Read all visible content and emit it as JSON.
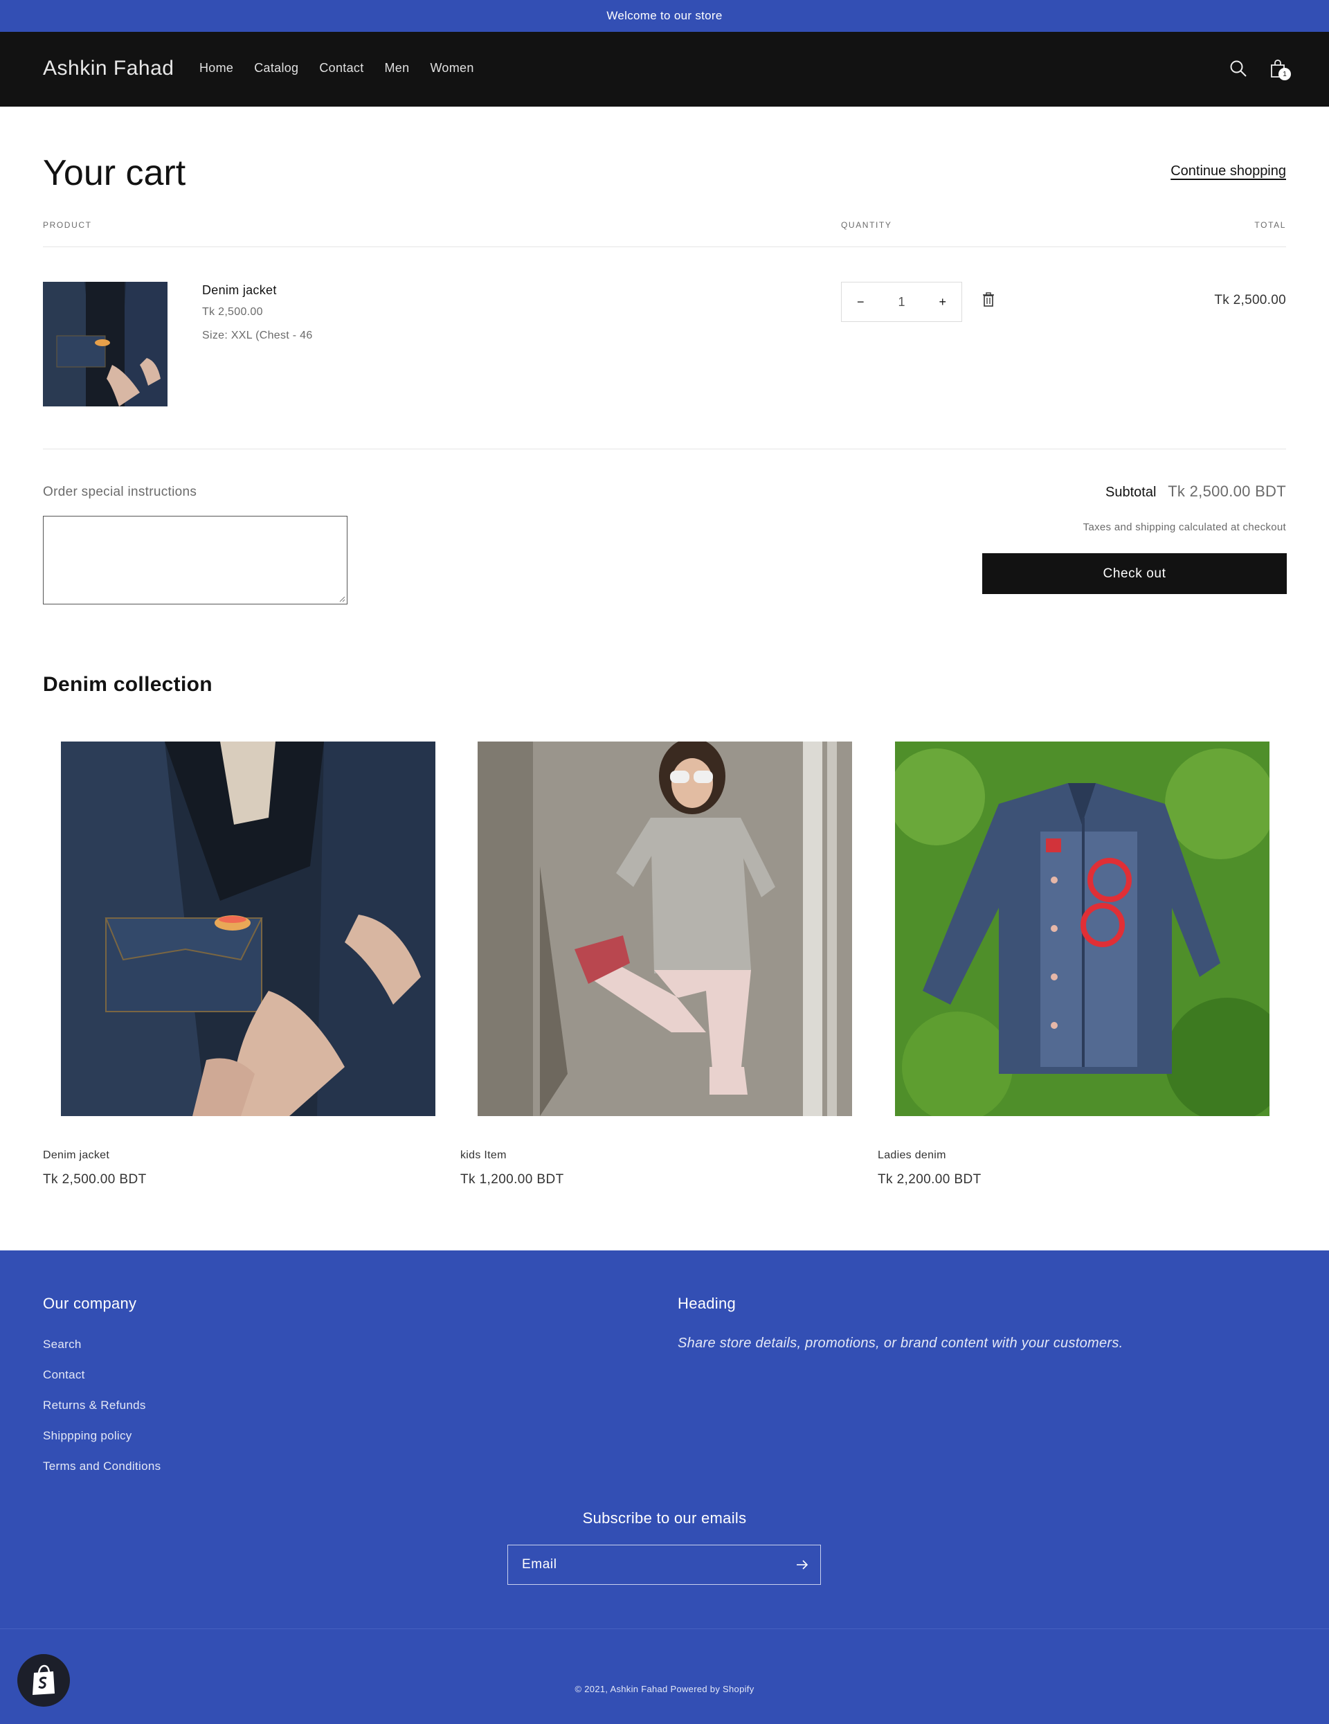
{
  "announcement": "Welcome to our store",
  "header": {
    "logo": "Ashkin Fahad",
    "nav": [
      "Home",
      "Catalog",
      "Contact",
      "Men",
      "Women"
    ],
    "cart_count": "1"
  },
  "cart": {
    "title": "Your cart",
    "continue_label": "Continue shopping",
    "columns": {
      "product": "PRODUCT",
      "quantity": "QUANTITY",
      "total": "TOTAL"
    },
    "item": {
      "name": "Denim jacket",
      "price": "Tk 2,500.00",
      "size": "Size: XXL (Chest - 46",
      "quantity": "1",
      "qty_minus": "−",
      "qty_plus": "+",
      "total": "Tk 2,500.00"
    },
    "instructions_label": "Order special instructions",
    "instructions_value": "",
    "subtotal_label": "Subtotal",
    "subtotal_value": "Tk 2,500.00 BDT",
    "tax_note": "Taxes and shipping calculated at checkout",
    "checkout_label": "Check out"
  },
  "collection": {
    "title": "Denim collection",
    "products": [
      {
        "name": "Denim jacket",
        "price": "Tk 2,500.00 BDT"
      },
      {
        "name": "kids Item",
        "price": "Tk 1,200.00 BDT"
      },
      {
        "name": "Ladies denim",
        "price": "Tk 2,200.00 BDT"
      }
    ]
  },
  "footer": {
    "company_heading": "Our company",
    "links": [
      "Search",
      "Contact",
      "Returns & Refunds",
      "Shippping policy",
      "Terms and Conditions"
    ],
    "heading2": "Heading",
    "text": "Share store details, promotions, or brand content with your customers.",
    "subscribe_title": "Subscribe to our emails",
    "email_placeholder": "Email",
    "copyright": "© 2021, Ashkin Fahad Powered by Shopify"
  },
  "colors": {
    "accent": "#334fb4",
    "dark": "#121212"
  }
}
